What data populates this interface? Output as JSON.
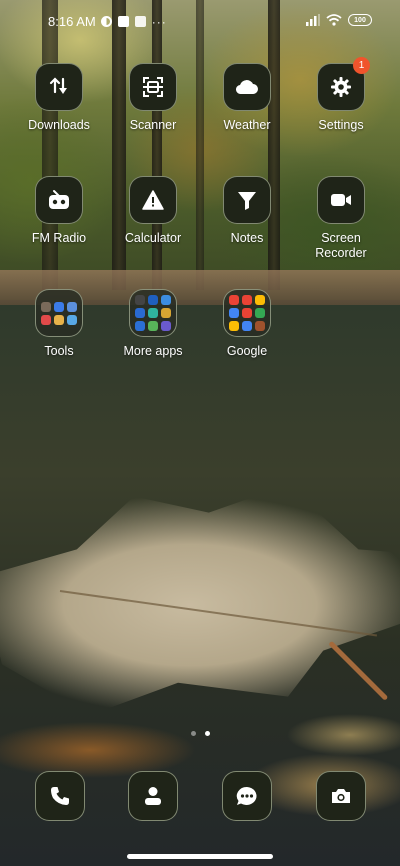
{
  "status_bar": {
    "time": "8:16 AM",
    "battery_level": "100",
    "icons": [
      "sync-icon",
      "gallery-notification-icon",
      "flipboard-notification-icon",
      "more-notifications-icon",
      "signal-icon",
      "wifi-icon",
      "battery-icon"
    ]
  },
  "apps": [
    {
      "label": "Downloads",
      "icon": "download-arrows-icon"
    },
    {
      "label": "Scanner",
      "icon": "scanner-icon"
    },
    {
      "label": "Weather",
      "icon": "cloud-icon"
    },
    {
      "label": "Settings",
      "icon": "gear-icon",
      "badge": "1"
    },
    {
      "label": "FM Radio",
      "icon": "radio-icon"
    },
    {
      "label": "Calculator",
      "icon": "calculator-icon"
    },
    {
      "label": "Notes",
      "icon": "notes-icon"
    },
    {
      "label": "Screen Recorder",
      "icon": "video-camera-icon"
    }
  ],
  "folders": [
    {
      "label": "Tools",
      "icon": "folder-icon",
      "mini_colors": [
        "#7a6a5a",
        "#3b7be8",
        "#5b8fdc",
        "#e24a4a",
        "#e7b24a",
        "#58a8e6"
      ]
    },
    {
      "label": "More apps",
      "icon": "folder-icon",
      "mini_colors": [
        "#444444",
        "#1f5fbf",
        "#3c8de0",
        "#2a6ad1",
        "#2fb3a0",
        "#d6a532",
        "#2b6fd6",
        "#58b35a",
        "#6a5acd",
        "#32a852",
        "#3f3f3f",
        "#5f5f5f"
      ]
    },
    {
      "label": "Google",
      "icon": "folder-icon",
      "mini_colors": [
        "#ea4335",
        "#ea4335",
        "#fbbc05",
        "#4285f4",
        "#ea4335",
        "#34a853",
        "#fbbc05",
        "#4285f4",
        "#a0522d"
      ]
    }
  ],
  "dock": [
    {
      "name": "phone",
      "icon": "phone-icon"
    },
    {
      "name": "contacts",
      "icon": "contacts-icon"
    },
    {
      "name": "messages",
      "icon": "chat-bubble-icon"
    },
    {
      "name": "camera",
      "icon": "camera-icon"
    }
  ],
  "page_indicator": {
    "pages": 2,
    "current": 2
  },
  "colors": {
    "tile_bg": "#1f2418",
    "badge": "#f0542c",
    "text": "#ffffff"
  }
}
